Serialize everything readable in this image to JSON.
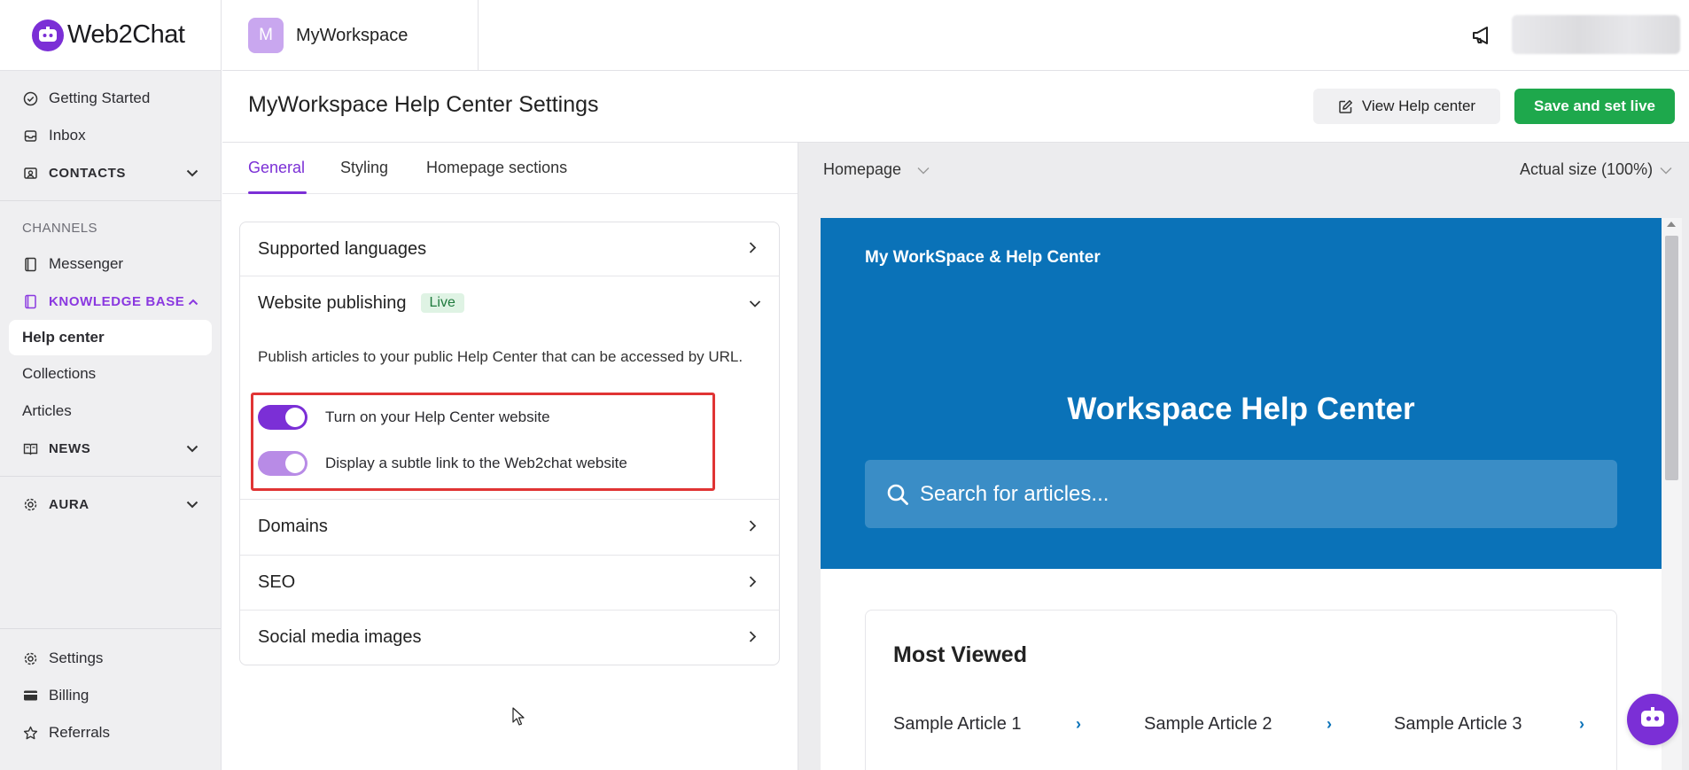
{
  "app": {
    "brand": "Web2Chat"
  },
  "workspace": {
    "initial": "M",
    "name": "MyWorkspace"
  },
  "sidebar": {
    "items": [
      {
        "label": "Getting Started",
        "icon": "check-circle-icon"
      },
      {
        "label": "Inbox",
        "icon": "inbox-icon"
      },
      {
        "label": "CONTACTS",
        "icon": "contacts-icon"
      }
    ],
    "channels_heading": "CHANNELS",
    "messenger": "Messenger",
    "knowledge_base": "KNOWLEDGE BASE",
    "kb_sub": [
      "Help center",
      "Collections",
      "Articles"
    ],
    "news": "NEWS",
    "aura": "AURA",
    "bottom": [
      "Settings",
      "Billing",
      "Referrals"
    ]
  },
  "page": {
    "title": "MyWorkspace Help Center Settings",
    "view_button": "View Help center",
    "save_button": "Save and set live"
  },
  "tabs": [
    "General",
    "Styling",
    "Homepage sections"
  ],
  "active_tab": "General",
  "settings": {
    "supported_languages": "Supported languages",
    "website_publishing": "Website publishing",
    "live_badge": "Live",
    "publishing_desc": "Publish articles to your public Help Center that can be accessed by URL.",
    "toggle_website": {
      "label": "Turn on your Help Center website",
      "on": true
    },
    "toggle_link": {
      "label": "Display a subtle link to the Web2chat website",
      "on": true
    },
    "domains": "Domains",
    "seo": "SEO",
    "social_media_images": "Social media images"
  },
  "preview": {
    "page_select": "Homepage",
    "size_select": "Actual size (100%)",
    "brand": "My WorkSpace & Help Center",
    "hero_title": "Workspace Help Center",
    "search_placeholder": "Search for articles...",
    "most_viewed_title": "Most Viewed",
    "articles": [
      "Sample Article 1",
      "Sample Article 2",
      "Sample Article 3"
    ]
  },
  "colors": {
    "accent": "#7b2fd6",
    "save_green": "#1ea84c",
    "hero_blue": "#0a72b8",
    "highlight_red": "#e03434"
  }
}
